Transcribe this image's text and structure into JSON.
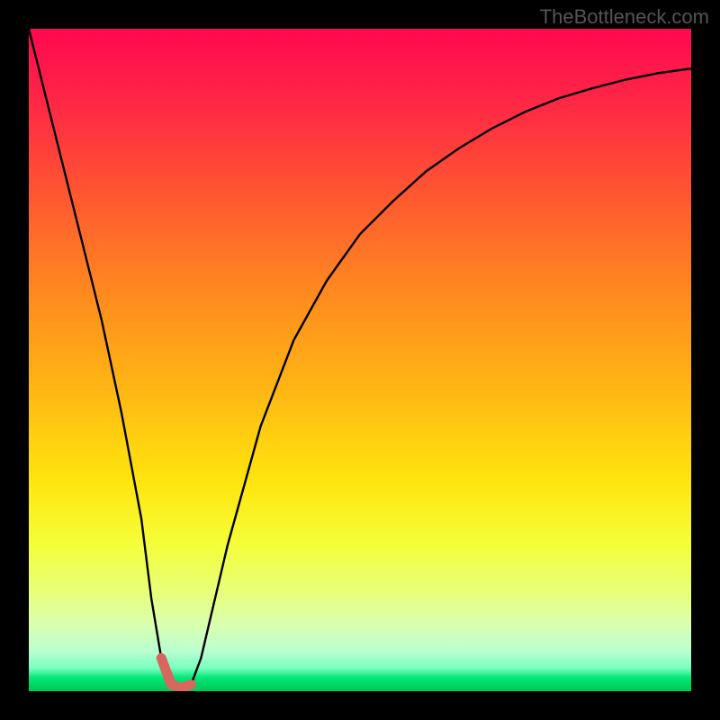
{
  "attribution": "TheBottleneck.com",
  "chart_data": {
    "type": "line",
    "title": "",
    "xlabel": "",
    "ylabel": "",
    "xlim": [
      0,
      100
    ],
    "ylim": [
      0,
      100
    ],
    "x": [
      0,
      2,
      5,
      8,
      11,
      14,
      17,
      18.5,
      20,
      21.5,
      23,
      24.5,
      26,
      30,
      35,
      40,
      45,
      50,
      55,
      60,
      65,
      70,
      75,
      80,
      85,
      90,
      95,
      100
    ],
    "values": [
      100,
      92,
      80,
      68,
      56,
      42,
      26,
      14,
      5,
      1,
      0.5,
      1,
      5,
      22,
      40,
      53,
      62,
      69,
      74,
      78.5,
      82,
      85,
      87.5,
      89.5,
      91,
      92.3,
      93.3,
      94
    ],
    "minimum_marker": {
      "x_range": [
        19.5,
        24.5
      ],
      "color": "#d8675f"
    },
    "gradient_stops": [
      {
        "offset": 0.0,
        "color": "#ff0850"
      },
      {
        "offset": 0.68,
        "color": "#ffe40d"
      },
      {
        "offset": 0.98,
        "color": "#00e676"
      },
      {
        "offset": 1.0,
        "color": "#00c853"
      }
    ]
  }
}
